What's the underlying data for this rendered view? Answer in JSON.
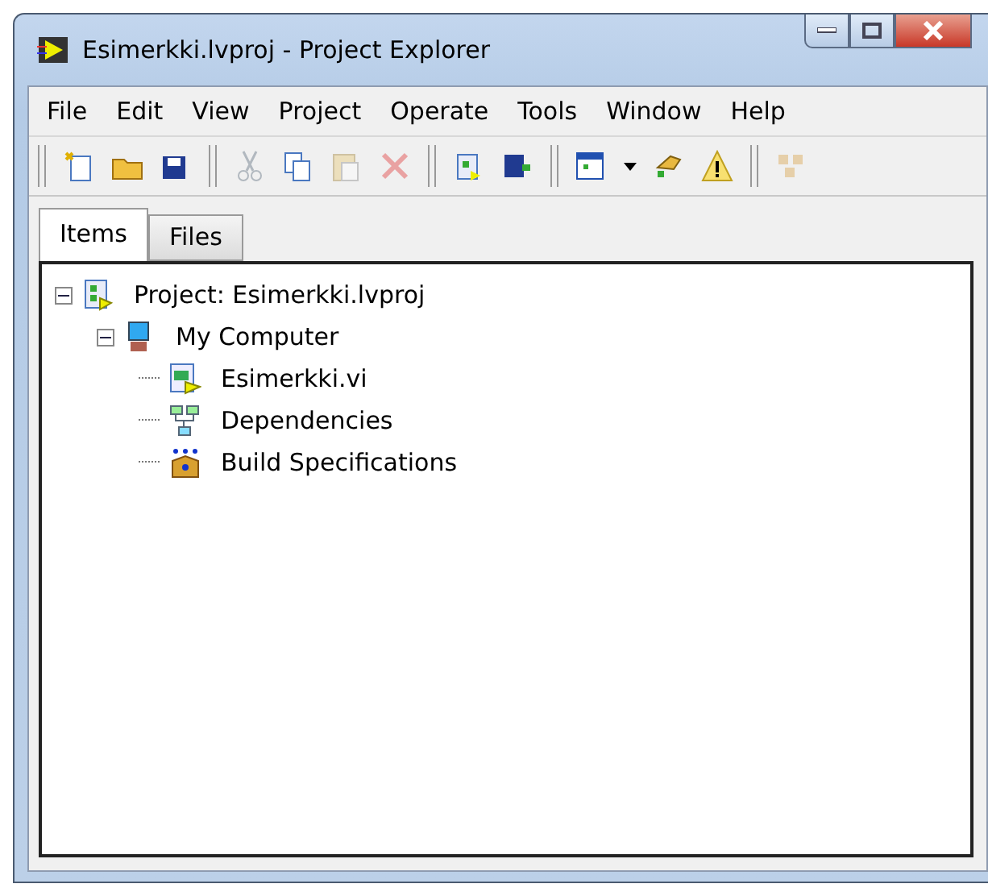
{
  "window": {
    "title": "Esimerkki.lvproj - Project Explorer"
  },
  "menu": [
    "File",
    "Edit",
    "View",
    "Project",
    "Operate",
    "Tools",
    "Window",
    "Help"
  ],
  "toolbar": [
    {
      "kind": "sep"
    },
    {
      "kind": "new",
      "disabled": false
    },
    {
      "kind": "open",
      "disabled": false
    },
    {
      "kind": "saveall",
      "disabled": false
    },
    {
      "kind": "sep"
    },
    {
      "kind": "cut",
      "disabled": true
    },
    {
      "kind": "copy",
      "disabled": false
    },
    {
      "kind": "paste",
      "disabled": true
    },
    {
      "kind": "delete",
      "disabled": true
    },
    {
      "kind": "sep"
    },
    {
      "kind": "newproj",
      "disabled": false
    },
    {
      "kind": "saveproj",
      "disabled": false
    },
    {
      "kind": "sep"
    },
    {
      "kind": "view",
      "disabled": false
    },
    {
      "kind": "dropdown",
      "disabled": false
    },
    {
      "kind": "wizard",
      "disabled": false
    },
    {
      "kind": "warning",
      "disabled": false
    },
    {
      "kind": "sep"
    },
    {
      "kind": "build",
      "disabled": true
    }
  ],
  "tabs": [
    {
      "label": "Items",
      "selected": true
    },
    {
      "label": "Files",
      "selected": false
    }
  ],
  "tree": [
    {
      "label": "Project: Esimerkki.lvproj",
      "kind": "project",
      "expanded": true,
      "children": [
        {
          "label": "My Computer",
          "kind": "computer",
          "expanded": true,
          "children": [
            {
              "label": "Esimerkki.vi",
              "kind": "vi"
            },
            {
              "label": "Dependencies",
              "kind": "deps"
            },
            {
              "label": "Build Specifications",
              "kind": "build"
            }
          ]
        }
      ]
    }
  ]
}
